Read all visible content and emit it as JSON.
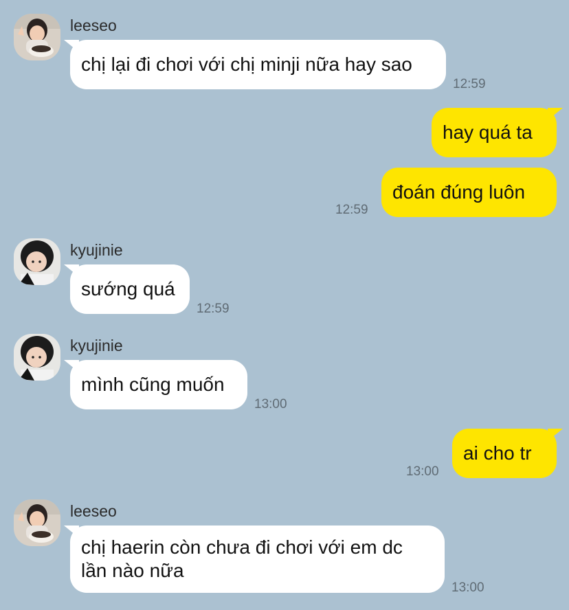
{
  "colors": {
    "background": "#abc1d1",
    "incoming_bubble": "#ffffff",
    "outgoing_bubble": "#fee500"
  },
  "messages": [
    {
      "sender": "leeseo",
      "avatar": "avatar-leeseo",
      "text": "chị lại đi chơi với chị minji nữa hay sao",
      "time": "12:59"
    },
    {
      "direction": "outgoing",
      "text": "hay quá ta"
    },
    {
      "direction": "outgoing",
      "text": "đoán đúng luôn",
      "time": "12:59"
    },
    {
      "sender": "kyujinie",
      "avatar": "avatar-kyujinie",
      "text": "sướng quá",
      "time": "12:59"
    },
    {
      "sender": "kyujinie",
      "avatar": "avatar-kyujinie",
      "text": "mình cũng muốn",
      "time": "13:00"
    },
    {
      "direction": "outgoing",
      "text": "ai cho tr",
      "time": "13:00"
    },
    {
      "sender": "leeseo",
      "avatar": "avatar-leeseo",
      "text_line1": "chị haerin còn chưa đi chơi với em dc",
      "text_line2": "lần nào nữa",
      "time": "13:00"
    }
  ]
}
